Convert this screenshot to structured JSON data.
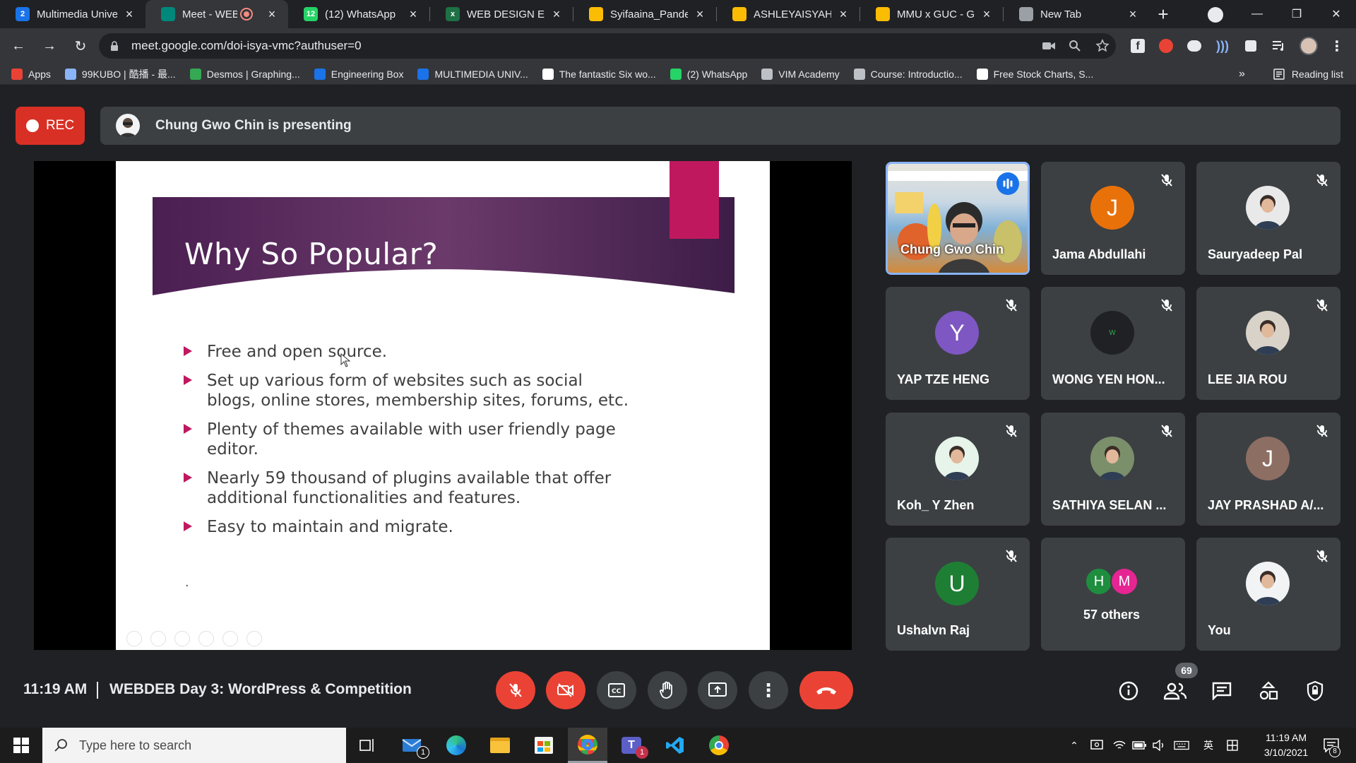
{
  "browser": {
    "tabs": [
      {
        "title": "Multimedia Unive",
        "favicon_color": "#1a73e8",
        "favicon_text": "2",
        "active": false
      },
      {
        "title": "Meet - WEBD",
        "favicon_color": "#00897b",
        "favicon_text": "",
        "active": true,
        "recording": true
      },
      {
        "title": "(12) WhatsApp",
        "favicon_color": "#25d366",
        "favicon_text": "12",
        "active": false
      },
      {
        "title": "WEB DESIGN EVA",
        "favicon_color": "#1e7145",
        "favicon_text": "x",
        "active": false
      },
      {
        "title": "Syifaaina_Pandem",
        "favicon_color": "#fbbc04",
        "favicon_text": "",
        "active": false
      },
      {
        "title": "ASHLEYAISYAH_TI",
        "favicon_color": "#fbbc04",
        "favicon_text": "",
        "active": false
      },
      {
        "title": "MMU x GUC - Go",
        "favicon_color": "#fbbc04",
        "favicon_text": "",
        "active": false
      },
      {
        "title": "New Tab",
        "favicon_color": "#9aa0a6",
        "favicon_text": "",
        "active": false
      }
    ],
    "new_tab_label": "+",
    "url": "meet.google.com/doi-isya-vmc?authuser=0",
    "bookmarks": [
      {
        "label": "Apps",
        "color": "#ea4335"
      },
      {
        "label": "99KUBO | 酷播 - 最...",
        "color": "#8ab4f8"
      },
      {
        "label": "Desmos | Graphing...",
        "color": "#34a853"
      },
      {
        "label": "Engineering Box",
        "color": "#1a73e8"
      },
      {
        "label": "MULTIMEDIA UNIV...",
        "color": "#1a73e8"
      },
      {
        "label": "The fantastic Six wo...",
        "color": "#ffffff"
      },
      {
        "label": "(2) WhatsApp",
        "color": "#25d366"
      },
      {
        "label": "VIM Academy",
        "color": "#bdc1c6"
      },
      {
        "label": "Course: Introductio...",
        "color": "#bdc1c6"
      },
      {
        "label": "Free Stock Charts, S...",
        "color": "#ffffff"
      }
    ],
    "bookmarks_more": "»",
    "reading_list": "Reading list"
  },
  "meet": {
    "rec_label": "REC",
    "presenting_text": "Chung Gwo Chin is presenting",
    "slide": {
      "title": "Why So Popular?",
      "bullets": [
        "Free and open source.",
        "Set up various form of websites such as social blogs, online stores, membership sites, forums, etc.",
        "Plenty of themes available with user friendly page editor.",
        "Nearly 59 thousand of plugins available that offer additional functionalities and features.",
        "Easy to maintain and migrate."
      ],
      "trailing_mark": ".",
      "accent_color": "#c0185f"
    },
    "participants": [
      {
        "name": "Chung Gwo Chin",
        "initial": "",
        "color": "#6b8fb5",
        "speaking": true,
        "muted": false,
        "video": true
      },
      {
        "name": "Jama Abdullahi",
        "initial": "J",
        "color": "#e8710a",
        "speaking": false,
        "muted": true
      },
      {
        "name": "Sauryadeep Pal",
        "initial": "",
        "color": "#e9e9e9",
        "speaking": false,
        "muted": true
      },
      {
        "name": "YAP TZE HENG",
        "initial": "Y",
        "color": "#7e57c2",
        "speaking": false,
        "muted": true
      },
      {
        "name": "WONG YEN HON...",
        "initial": "W",
        "color": "#202124",
        "speaking": false,
        "muted": true
      },
      {
        "name": "LEE JIA ROU",
        "initial": "",
        "color": "#d9d2c8",
        "speaking": false,
        "muted": true
      },
      {
        "name": "Koh_ Y Zhen",
        "initial": "",
        "color": "#e6f4ea",
        "speaking": false,
        "muted": true
      },
      {
        "name": "SATHIYA SELAN ...",
        "initial": "",
        "color": "#7a8f6a",
        "speaking": false,
        "muted": true
      },
      {
        "name": "JAY PRASHAD A/...",
        "initial": "J",
        "color": "#8d6e63",
        "speaking": false,
        "muted": true
      },
      {
        "name": "Ushalvn Raj",
        "initial": "U",
        "color": "#1e7e34",
        "speaking": false,
        "muted": true
      },
      {
        "name": "57 others",
        "initial": "",
        "color": "",
        "speaking": false,
        "muted": false,
        "others": [
          {
            "initial": "H",
            "color": "#1e8e3e"
          },
          {
            "initial": "M",
            "color": "#e52592"
          }
        ]
      },
      {
        "name": "You",
        "initial": "",
        "color": "#f1f3f4",
        "speaking": false,
        "muted": true
      }
    ],
    "time": "11:19 AM",
    "separator": "|",
    "meeting_title": "WEBDEB Day 3: WordPress & Competition",
    "people_count": "69"
  },
  "taskbar": {
    "search_placeholder": "Type here to search",
    "mail_badge": "1",
    "teams_badge": "1",
    "ime_label": "英",
    "time": "11:19 AM",
    "date": "3/10/2021",
    "notification_count": "8"
  }
}
